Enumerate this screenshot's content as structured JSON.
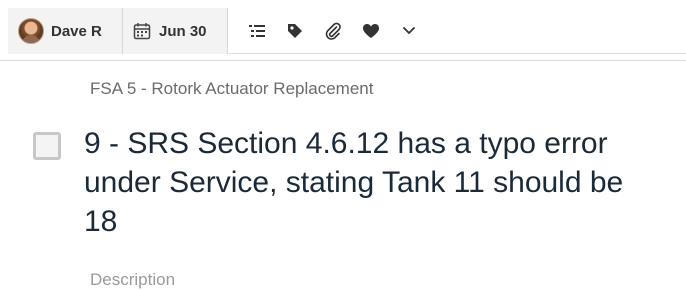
{
  "toolbar": {
    "assignee": {
      "name": "Dave R",
      "avatar_icon": "user-avatar"
    },
    "due_date": {
      "label": "Jun 30",
      "icon": "calendar-icon"
    },
    "actions": [
      {
        "name": "subtasks",
        "icon": "checklist-icon"
      },
      {
        "name": "tags",
        "icon": "tag-icon"
      },
      {
        "name": "attachments",
        "icon": "paperclip-icon"
      },
      {
        "name": "like",
        "icon": "heart-icon"
      },
      {
        "name": "more",
        "icon": "chevron-down-icon"
      }
    ]
  },
  "task": {
    "project": "FSA 5 - Rotork Actuator Replacement",
    "title": "9 - SRS Section 4.6.12 has a typo error\nunder Service, stating Tank 11 should be\n18",
    "completed": false
  },
  "description": {
    "label": "Description"
  },
  "colors": {
    "title_text": "#1b2a38",
    "breadcrumb_text": "#6b6b6b",
    "description_label": "#9a9a9a",
    "toolbar_bg": "#f3f3f3",
    "divider": "#dcdcdc"
  }
}
